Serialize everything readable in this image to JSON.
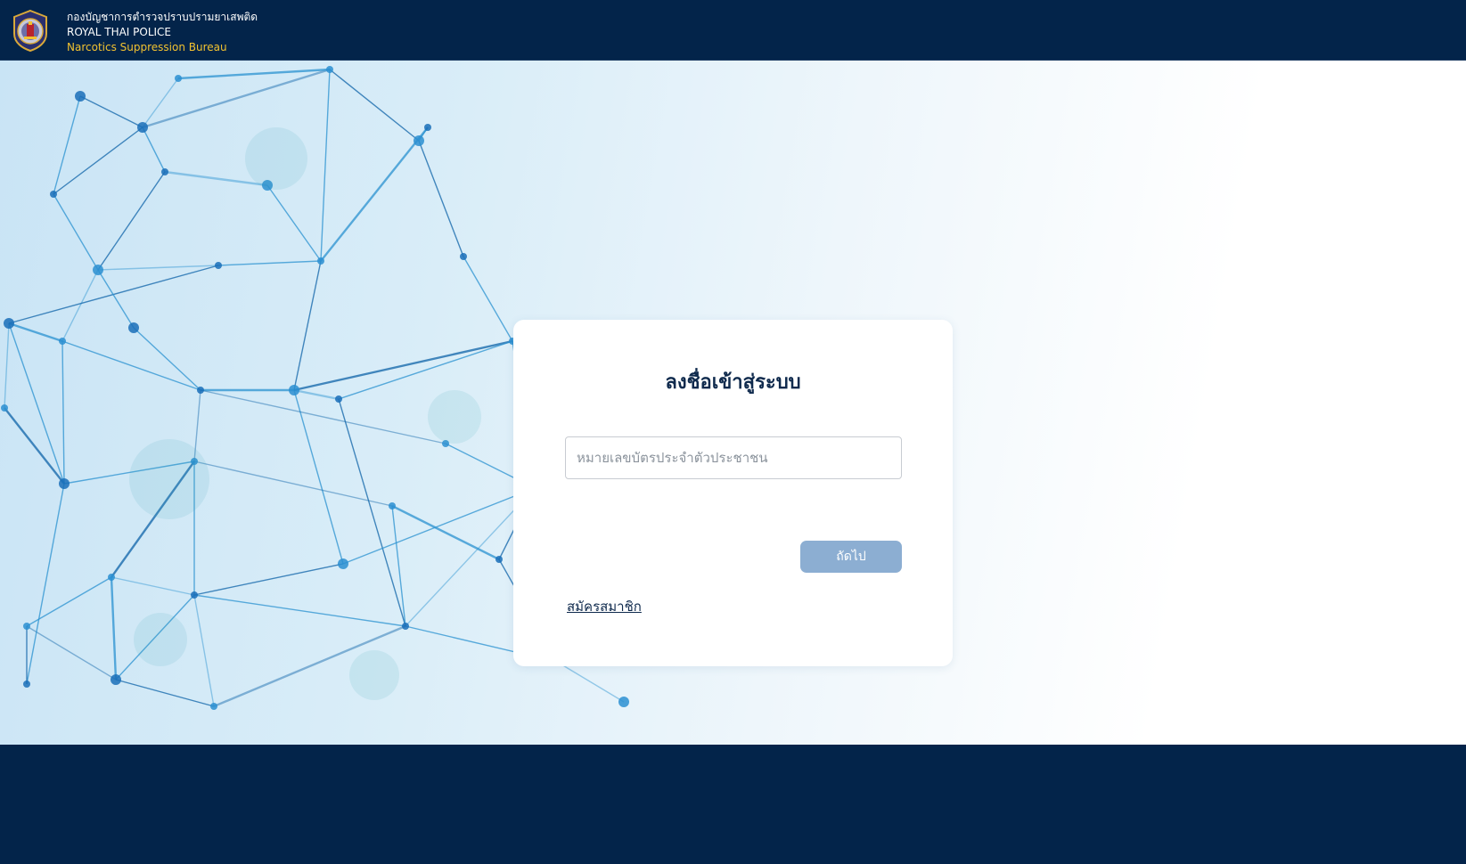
{
  "header": {
    "org_thai": "กองบัญชาการตำรวจปราบปรามยาเสพติด",
    "org_english": "ROYAL THAI POLICE",
    "bureau": "Narcotics Suppression Bureau",
    "logo_icon": "police-emblem-icon"
  },
  "login": {
    "title": "ลงชื่อเข้าสู่ระบบ",
    "id_placeholder": "หมายเลขบัตรประจำตัวประชาชน",
    "id_value": "",
    "next_label": "ถัดไป",
    "register_label": "สมัครสมาชิก"
  },
  "colors": {
    "navy": "#03244a",
    "gold": "#f2c230",
    "button": "#8caed2",
    "network_line": "#1a7fc4"
  }
}
